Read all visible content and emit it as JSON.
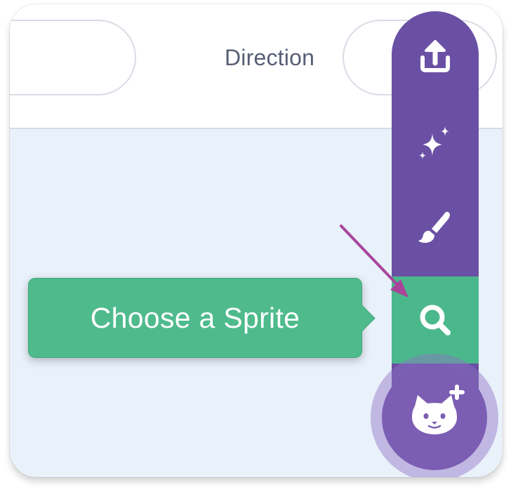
{
  "panel": {
    "direction_label": "Direction"
  },
  "sprite_menu": {
    "items": [
      {
        "name": "upload-sprite",
        "icon": "upload-icon"
      },
      {
        "name": "surprise",
        "icon": "sparkles-icon"
      },
      {
        "name": "paint",
        "icon": "paintbrush-icon"
      },
      {
        "name": "choose-a-sprite",
        "icon": "search-icon",
        "highlighted": true
      }
    ],
    "main_button_icon": "cat-plus-icon",
    "tooltip": "Choose a Sprite"
  },
  "colors": {
    "menu_purple": "#6a50a4",
    "highlight_green": "#4bb88c",
    "tooltip_green": "#4fbb8d",
    "annotation_arrow": "#a8459b",
    "stage_background": "#e9f1fb"
  }
}
